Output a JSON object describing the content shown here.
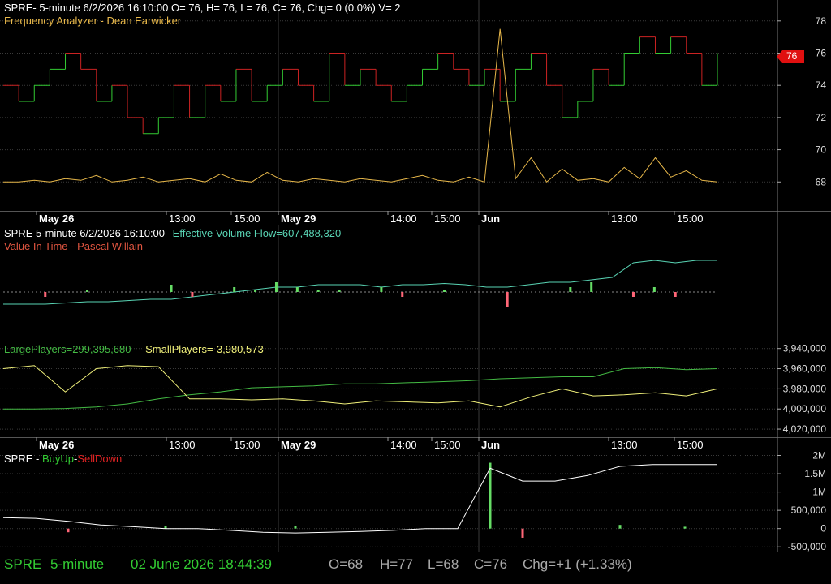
{
  "colors": {
    "background": "#000000",
    "grid": "#3a3a3a",
    "up": "#33cc33",
    "down": "#cc2222",
    "orange_line": "#e8b84a",
    "white_line": "#ffffff",
    "teal_line": "#59d4b4",
    "large_players": "#44bb44",
    "small_players": "#f0f07a",
    "vif_bar_up": "#66dd66",
    "vif_bar_down": "#ff6677",
    "status_green": "#33cc33",
    "status_gray": "#aaaaaa"
  },
  "panes": {
    "price": {
      "header1": "SPRE- 5-minute 6/2/2026 16:10:00 O= 76, H= 76, L= 76, C= 76, Chg= 0 (0.0%) V= 2",
      "header2": "Frequency Analyzer - Dean Earwicker",
      "last_price_badge": "76"
    },
    "volume_flow": {
      "header_prefix": "SPRE 5-minute  6/2/2026 16:10:00",
      "header_flow": "Effective Volume Flow=607,488,320",
      "header2": "Value In Time - Pascal Willain"
    },
    "players": {
      "large": "LargePlayers=299,395,680",
      "small": "SmallPlayers=-3,980,573"
    },
    "buyup": {
      "prefix": "SPRE - ",
      "buy": "BuyUp",
      "dash": "-",
      "sell": "SellDown"
    }
  },
  "status_bar": {
    "symbol": "SPRE",
    "interval": "5-minute",
    "datetime": "02 June 2026 18:44:39",
    "open": "O=68",
    "high": "H=77",
    "low": "L=68",
    "close": "C=76",
    "change": "Chg=+1 (+1.33%)"
  },
  "chart_data": [
    {
      "type": "line",
      "title": "SPRE- 5-minute 6/2/2026 16:10:00 O= 76, H= 76, L= 76, C= 76, Chg= 0 (0.0%) V= 2",
      "x_ticks": [
        "May 26",
        "13:00",
        "15:00",
        "May 29",
        "14:00",
        "15:00",
        "Jun",
        "13:00",
        "15:00"
      ],
      "y_ticks": [
        68,
        70,
        72,
        74,
        76,
        78
      ],
      "ylim": [
        66.2,
        79.3
      ],
      "grid": true,
      "series": [
        {
          "name": "Frequency Analyzer - Dean Earwicker",
          "style": "step",
          "values": [
            74,
            73,
            74,
            75,
            76,
            75,
            73,
            74,
            72,
            71,
            72,
            74,
            72,
            74,
            73,
            75,
            73,
            74,
            75,
            74,
            73,
            76,
            74,
            75,
            74,
            73,
            74,
            75,
            76,
            75,
            74,
            75,
            73,
            75,
            76,
            74,
            72,
            73,
            75,
            74,
            76,
            77,
            76,
            77,
            76,
            74,
            76
          ]
        },
        {
          "values": [
            68,
            68,
            68.1,
            68,
            68.2,
            68.1,
            68.4,
            68,
            68.1,
            68.3,
            68,
            68.1,
            68.2,
            68,
            68.5,
            68.1,
            68,
            68.6,
            68.1,
            68,
            68.2,
            68.1,
            68,
            68.2,
            68.1,
            68,
            68.2,
            68.4,
            68.1,
            68,
            68.3,
            68,
            77.5,
            68.2,
            69.5,
            68,
            68.8,
            68.1,
            68.2,
            68,
            68.9,
            68.2,
            69.5,
            68.3,
            68.7,
            68.1,
            68
          ]
        }
      ]
    },
    {
      "type": "bar",
      "title": "SPRE 5-minute  6/2/2026 16:10:00",
      "series": [
        {
          "name": "Effective Volume Flow",
          "style": "line",
          "values": [
            1,
            1,
            1,
            1.5,
            2,
            2,
            2.5,
            3,
            3,
            4,
            5,
            6,
            7,
            8,
            8,
            9,
            9,
            9,
            8,
            9,
            9,
            9.5,
            9,
            8,
            8,
            9,
            10,
            10,
            11,
            12,
            18,
            19,
            18,
            19,
            19
          ]
        },
        {
          "name": "Value In Time - Pascal Willain",
          "values": [
            0,
            0,
            -1,
            0,
            0.5,
            0,
            0,
            0,
            1.5,
            -1,
            0,
            1,
            0.5,
            2,
            1,
            0.5,
            0.5,
            0,
            1,
            -1,
            0,
            0.5,
            0,
            0,
            -3,
            0,
            0,
            1,
            2,
            0,
            -1,
            1,
            -1,
            0,
            0
          ]
        }
      ]
    },
    {
      "type": "line",
      "y_ticks": [
        "3,940,000",
        "3,960,000",
        "3,980,000",
        "4,000,000",
        "4,020,000"
      ],
      "ylim": [
        -4028000,
        -3933000
      ],
      "grid": true,
      "series": [
        {
          "name": "LargePlayers",
          "values": [
            -4000000,
            -4000000,
            -3999500,
            -3998000,
            -3995000,
            -3990000,
            -3986000,
            -3983000,
            -3979000,
            -3978000,
            -3977000,
            -3975000,
            -3975000,
            -3974000,
            -3973000,
            -3972000,
            -3970000,
            -3969000,
            -3968000,
            -3968000,
            -3960000,
            -3959000,
            -3961000,
            -3960000
          ]
        },
        {
          "name": "SmallPlayers",
          "values": [
            -3960000,
            -3957000,
            -3983000,
            -3960000,
            -3957000,
            -3958000,
            -3990000,
            -3990000,
            -3991000,
            -3990000,
            -3992000,
            -3995000,
            -3992000,
            -3993000,
            -3994000,
            -3992000,
            -3998000,
            -3988000,
            -3980000,
            -3987000,
            -3986000,
            -3984000,
            -3987000,
            -3980000
          ]
        }
      ]
    },
    {
      "type": "bar",
      "title": "SPRE - BuyUp-SellDown",
      "y_ticks": [
        "2M",
        "1.5M",
        "1M",
        "500,000",
        "0",
        "-500,000"
      ],
      "ylim": [
        -650000,
        2100000
      ],
      "grid": true,
      "series": [
        {
          "name": "BuyUp-SellDown",
          "style": "line",
          "values": [
            300000,
            280000,
            200000,
            100000,
            50000,
            0,
            0,
            -50000,
            -100000,
            -120000,
            -100000,
            -80000,
            -50000,
            0,
            0,
            1650000,
            1300000,
            1300000,
            1450000,
            1700000,
            1750000,
            1750000,
            1750000
          ]
        },
        {
          "values": [
            0,
            0,
            -100000,
            0,
            0,
            80000,
            0,
            0,
            0,
            60000,
            0,
            0,
            0,
            0,
            0,
            1800000,
            -250000,
            0,
            0,
            100000,
            0,
            50000,
            0
          ]
        }
      ]
    }
  ]
}
